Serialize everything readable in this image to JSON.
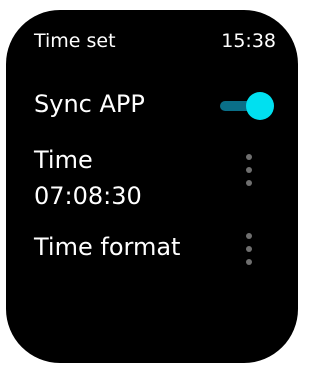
{
  "header": {
    "title": "Time set",
    "clock": "15:38"
  },
  "sync": {
    "label": "Sync APP",
    "enabled": true
  },
  "time": {
    "label": "Time",
    "value": "07:08:30",
    "menu_icon": "more-vertical-icon"
  },
  "time_format": {
    "label": "Time format",
    "menu_icon": "more-vertical-icon"
  },
  "colors": {
    "background": "#000000",
    "text": "#ffffff",
    "toggle_knob": "#00e0f0",
    "toggle_track": "#0a6f88",
    "menu_dots": "#6f6f6f"
  }
}
